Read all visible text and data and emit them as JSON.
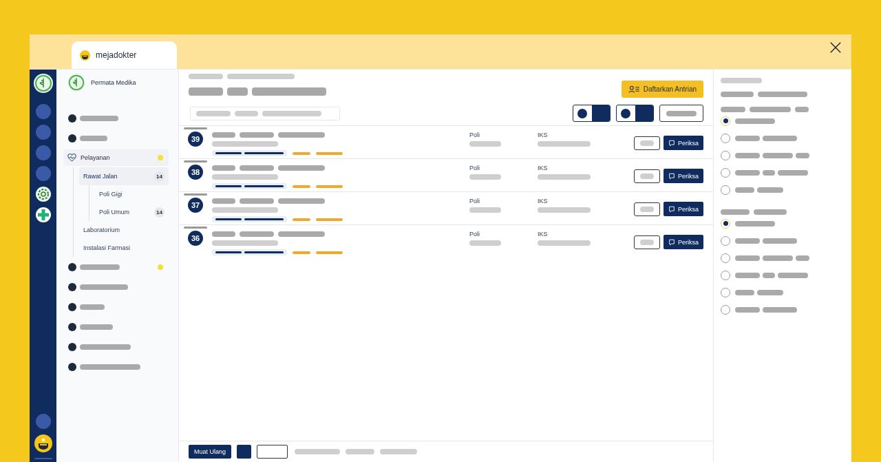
{
  "app_tab": {
    "title": "mejadokter"
  },
  "clinic": {
    "name": "Permata Medika"
  },
  "nav": [
    {
      "kind": "placeholder",
      "notification": false
    },
    {
      "kind": "placeholder",
      "notification": false
    },
    {
      "kind": "menu",
      "label": "Pelayanan",
      "notification": true,
      "children": [
        {
          "label": "Rawat Jalan",
          "selected": true,
          "badge": "14",
          "children": [
            {
              "label": "Poli Gigi",
              "selected": false
            },
            {
              "label": "Poli Umum",
              "selected": false,
              "badge": "14"
            }
          ]
        },
        {
          "label": "Laboratorium",
          "selected": false
        },
        {
          "label": "Instalasi Farmasi",
          "selected": false
        }
      ]
    },
    {
      "kind": "placeholder",
      "notification": true
    },
    {
      "kind": "placeholder",
      "notification": false
    },
    {
      "kind": "placeholder",
      "notification": false
    },
    {
      "kind": "placeholder",
      "notification": false
    },
    {
      "kind": "placeholder",
      "notification": false
    },
    {
      "kind": "placeholder",
      "notification": false
    }
  ],
  "header": {
    "register_button": "Daftarkan Antrian",
    "toggles": [
      {
        "on": true
      },
      {
        "on": true
      }
    ]
  },
  "queue": [
    {
      "number": "39",
      "poli_label": "Poli",
      "insurance_label": "IKS",
      "action": "Periksa"
    },
    {
      "number": "38",
      "poli_label": "Poli",
      "insurance_label": "IKS",
      "action": "Periksa"
    },
    {
      "number": "37",
      "poli_label": "Poli",
      "insurance_label": "IKS",
      "action": "Periksa"
    },
    {
      "number": "36",
      "poli_label": "Poli",
      "insurance_label": "IKS",
      "action": "Periksa"
    }
  ],
  "footer": {
    "reload_button": "Muat Ulang"
  },
  "filters": [
    {
      "options": [
        {
          "selected": true
        },
        {
          "selected": false
        },
        {
          "selected": false
        },
        {
          "selected": false
        },
        {
          "selected": false
        }
      ]
    },
    {
      "options": [
        {
          "selected": true
        },
        {
          "selected": false
        },
        {
          "selected": false
        },
        {
          "selected": false
        },
        {
          "selected": false
        },
        {
          "selected": false
        }
      ]
    }
  ]
}
